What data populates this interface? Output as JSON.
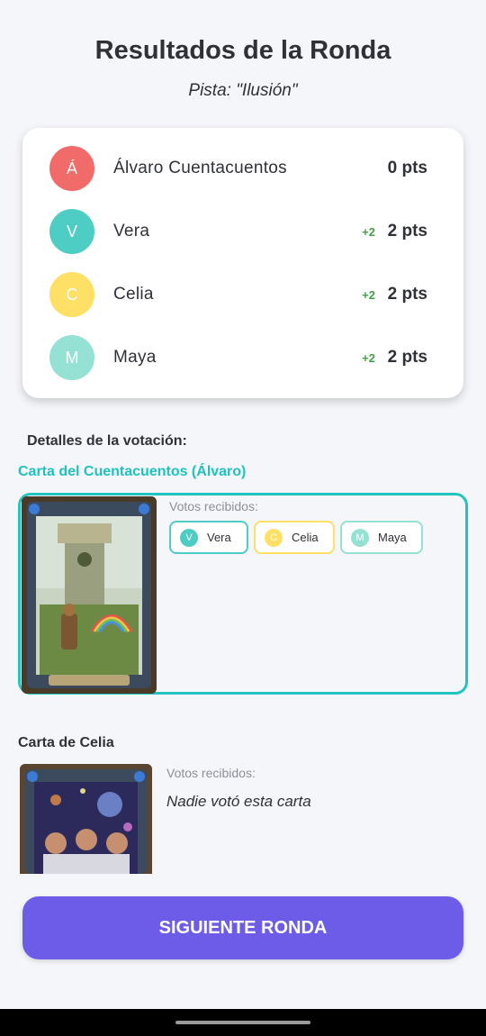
{
  "header": {
    "title": "Resultados de la Ronda",
    "hint": "Pista: \"Ilusión\""
  },
  "scores": [
    {
      "initial": "Á",
      "name": "Álvaro Cuentacuentos",
      "delta": "",
      "points": "0 pts",
      "color": "#f26b6b"
    },
    {
      "initial": "V",
      "name": "Vera",
      "delta": "+2",
      "points": "2 pts",
      "color": "#4ecdc4"
    },
    {
      "initial": "C",
      "name": "Celia",
      "delta": "+2",
      "points": "2 pts",
      "color": "#ffe066"
    },
    {
      "initial": "M",
      "name": "Maya",
      "delta": "+2",
      "points": "2 pts",
      "color": "#95e1d3"
    }
  ],
  "details_label": "Detalles de la votación:",
  "cards": [
    {
      "title": "Carta del Cuentacuentos (Álvaro)",
      "votes_label": "Votos recibidos:",
      "voters": [
        {
          "initial": "V",
          "name": "Vera",
          "color": "#4ecdc4"
        },
        {
          "initial": "C",
          "name": "Celia",
          "color": "#ffe066"
        },
        {
          "initial": "M",
          "name": "Maya",
          "color": "#95e1d3"
        }
      ]
    },
    {
      "title": "Carta de Celia",
      "votes_label": "Votos recibidos:",
      "no_votes": "Nadie votó esta carta"
    }
  ],
  "next_button": "SIGUIENTE RONDA",
  "colors": {
    "accent": "#22c4bf",
    "button": "#6c5ce7",
    "delta": "#43a047"
  }
}
